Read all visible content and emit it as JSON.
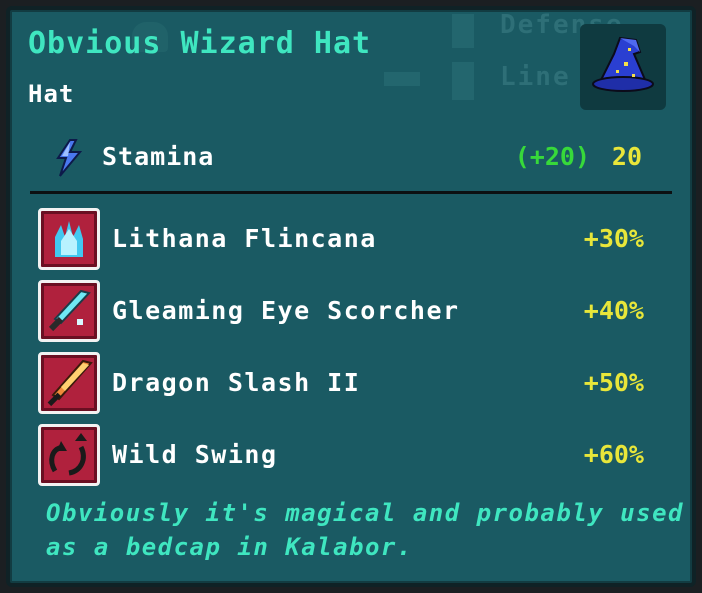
{
  "item": {
    "name": "Obvious Wizard Hat",
    "type": "Hat",
    "icon": "wizard-hat-icon"
  },
  "background_labels": {
    "defense": "Defense",
    "line": "Line"
  },
  "stat": {
    "icon": "stamina-bolt-icon",
    "label": "Stamina",
    "bonus": "(+20)",
    "value": "20"
  },
  "skills": [
    {
      "name": "Lithana Flincana",
      "bonus": "+30%",
      "icon": "blue-flame-hand-icon"
    },
    {
      "name": "Gleaming Eye Scorcher",
      "bonus": "+40%",
      "icon": "glowing-sword-icon"
    },
    {
      "name": "Dragon Slash II",
      "bonus": "+50%",
      "icon": "flame-sword-icon"
    },
    {
      "name": "Wild Swing",
      "bonus": "+60%",
      "icon": "swinging-arrows-icon"
    }
  ],
  "description": "Obviously it's magical and probably used as a bedcap in Kalabor.",
  "colors": {
    "panel": "#1a5a63",
    "title": "#3fe6c0",
    "bonus_green": "#37d93a",
    "value_yellow": "#e8e63a",
    "skill_icon_bg": "#b0213d"
  }
}
